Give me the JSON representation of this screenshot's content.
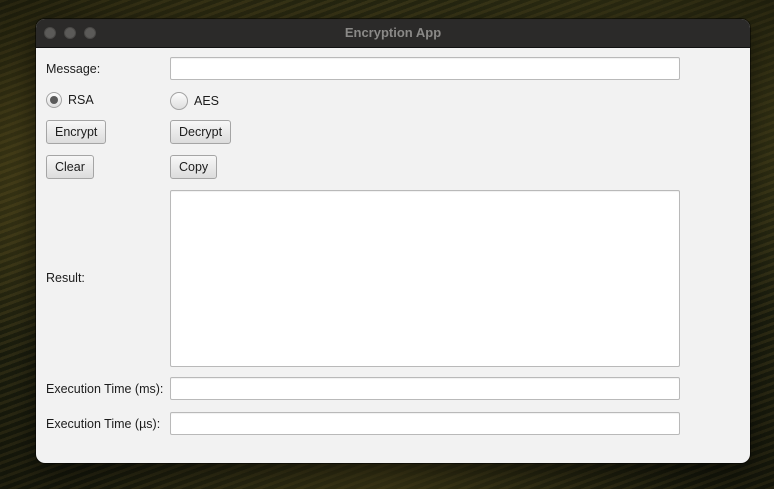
{
  "window": {
    "title": "Encryption App"
  },
  "form": {
    "message_label": "Message:",
    "message_value": "",
    "rsa_label": "RSA",
    "aes_label": "AES",
    "selected_algorithm": "RSA",
    "encrypt_label": "Encrypt",
    "decrypt_label": "Decrypt",
    "clear_label": "Clear",
    "copy_label": "Copy",
    "result_label": "Result:",
    "result_value": "",
    "exec_ms_label": "Execution Time (ms):",
    "exec_ms_value": "",
    "exec_us_label": "Execution Time (µs):",
    "exec_us_value": ""
  },
  "colors": {
    "window_bg": "#f2f2f2",
    "titlebar_bg": "#2b2a29",
    "title_text": "#8a8987"
  }
}
